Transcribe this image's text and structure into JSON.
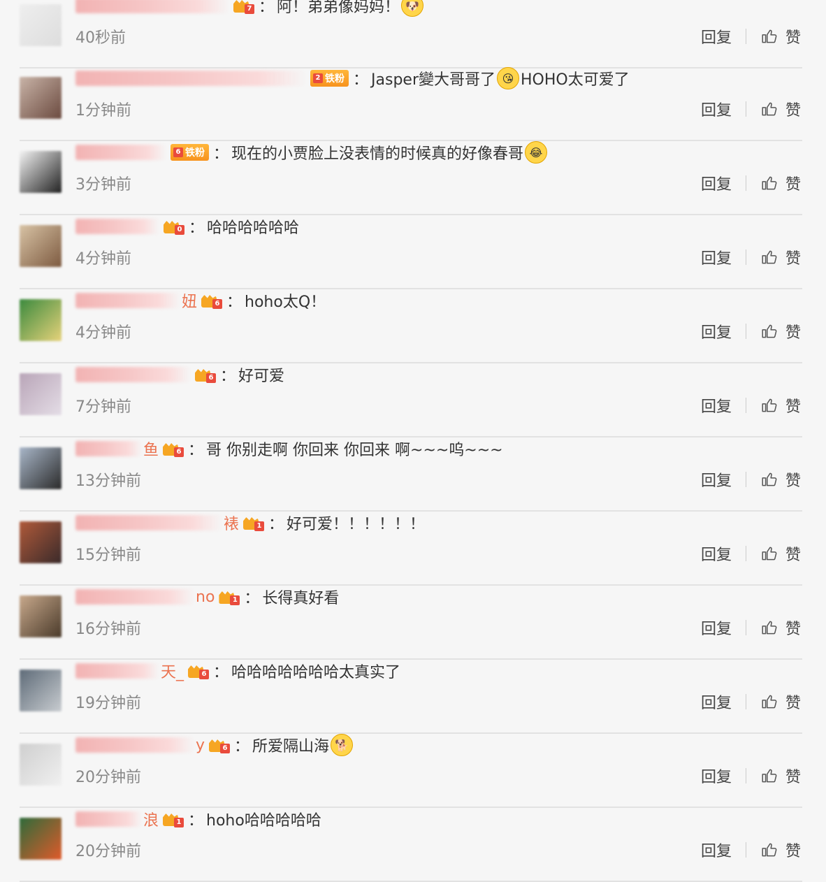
{
  "actions": {
    "reply": "回复",
    "like": "赞"
  },
  "comments": [
    {
      "name_tail": "",
      "fan_badge": "",
      "level": "7",
      "text_before": "阿！弟弟像妈妈！",
      "emoji": "dog-face",
      "text_after": "",
      "time": "40秒前"
    },
    {
      "name_tail": "",
      "fan_badge": "铁粉",
      "level": "2",
      "text_before": "Jasper變大哥哥了",
      "emoji": "kiss-face",
      "text_after": "HOHO太可爱了",
      "time": "1分钟前"
    },
    {
      "name_tail": "",
      "fan_badge": "铁粉",
      "level": "6",
      "text_before": "现在的小贾脸上没表情的时候真的好像春哥",
      "emoji": "laugh-cry-face",
      "text_after": "",
      "time": "3分钟前"
    },
    {
      "name_tail": "",
      "fan_badge": "",
      "level": "0",
      "text_before": "哈哈哈哈哈哈",
      "emoji": "",
      "text_after": "",
      "time": "4分钟前"
    },
    {
      "name_tail": "妞",
      "fan_badge": "",
      "level": "6",
      "text_before": "hoho太Q！",
      "emoji": "",
      "text_after": "",
      "time": "4分钟前"
    },
    {
      "name_tail": "",
      "fan_badge": "",
      "level": "6",
      "text_before": "好可爱",
      "emoji": "",
      "text_after": "",
      "time": "7分钟前"
    },
    {
      "name_tail": "鱼",
      "fan_badge": "",
      "level": "6",
      "text_before": "哥  你别走啊 你回来 你回来 啊~~~呜~~~",
      "emoji": "",
      "text_after": "",
      "time": "13分钟前"
    },
    {
      "name_tail": "裱",
      "fan_badge": "",
      "level": "1",
      "text_before": "好可爱！！！！！！",
      "emoji": "",
      "text_after": "",
      "time": "15分钟前"
    },
    {
      "name_tail": "no",
      "fan_badge": "",
      "level": "1",
      "text_before": "长得真好看",
      "emoji": "",
      "text_after": "",
      "time": "16分钟前"
    },
    {
      "name_tail": "天_",
      "fan_badge": "",
      "level": "6",
      "text_before": "哈哈哈哈哈哈哈太真实了",
      "emoji": "",
      "text_after": "",
      "time": "19分钟前"
    },
    {
      "name_tail": "y",
      "fan_badge": "",
      "level": "6",
      "text_before": "所爱隔山海",
      "emoji": "doge-face",
      "text_after": "",
      "time": "20分钟前"
    },
    {
      "name_tail": "浪",
      "fan_badge": "",
      "level": "1",
      "text_before": "hoho哈哈哈哈哈",
      "emoji": "",
      "text_after": "",
      "time": "20分钟前"
    }
  ]
}
